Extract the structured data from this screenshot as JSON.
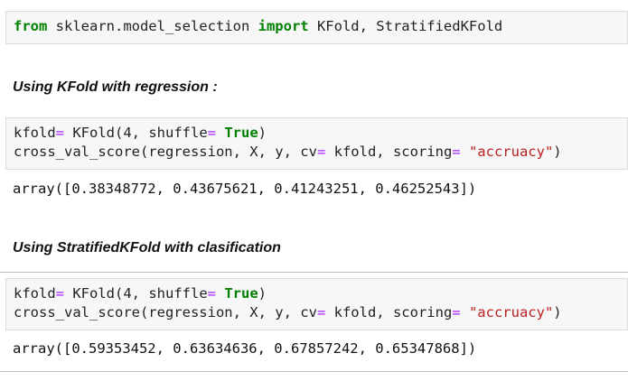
{
  "cell1": {
    "line1": {
      "kw_from": "from",
      "module": " sklearn.model_selection ",
      "kw_import": "import",
      "names": " KFold, StratifiedKFold"
    }
  },
  "section1": {
    "heading": "Using KFold with regression :"
  },
  "cell2": {
    "line1": {
      "pre": "kfold",
      "eq1": "=",
      "mid": " KFold(4, shuffle",
      "eq2": "=",
      "sp": " ",
      "kw_true": "True",
      "close": ")"
    },
    "line2": {
      "pre": "cross_val_score(regression, X, y, cv",
      "eq1": "=",
      "mid": " kfold, scoring",
      "eq2": "=",
      "sp": " ",
      "str": "\"accruacy\"",
      "close": ")"
    }
  },
  "output1": {
    "text": "array([0.38348772, 0.43675621, 0.41243251, 0.46252543])"
  },
  "section2": {
    "heading": "Using StratifiedKFold with clasification"
  },
  "cell3": {
    "line1": {
      "pre": "kfold",
      "eq1": "=",
      "mid": " KFold(4, shuffle",
      "eq2": "=",
      "sp": " ",
      "kw_true": "True",
      "close": ")"
    },
    "line2": {
      "pre": "cross_val_score(regression, X, y, cv",
      "eq1": "=",
      "mid": " kfold, scoring",
      "eq2": "=",
      "sp": " ",
      "str": "\"accruacy\"",
      "close": ")"
    }
  },
  "output2": {
    "text": "array([0.59353452, 0.63634636, 0.67857242, 0.65347868])"
  },
  "colors": {
    "keyword": "#008000",
    "string": "#ba2121",
    "operator": "#aa22ff",
    "cell_background": "#f7f7f7"
  }
}
